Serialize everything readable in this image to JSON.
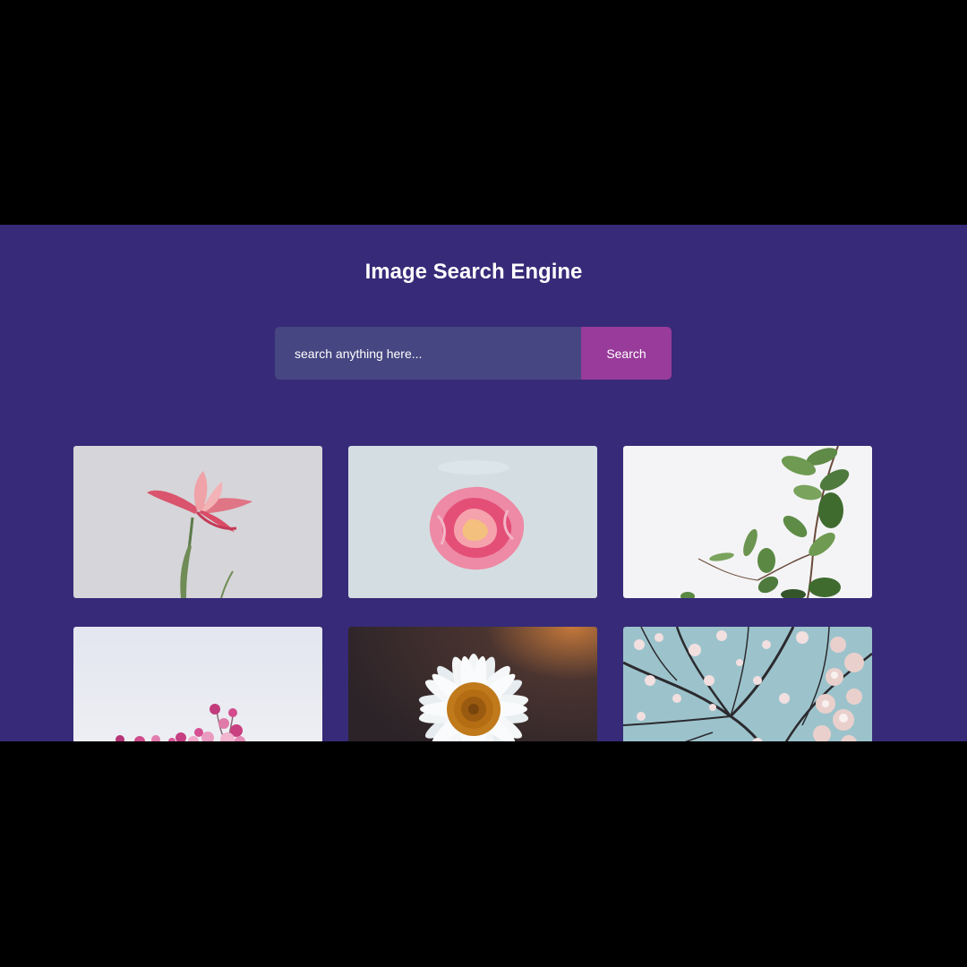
{
  "header": {
    "title": "Image Search Engine"
  },
  "search": {
    "placeholder": "search anything here...",
    "value": "",
    "button_label": "Search"
  },
  "colors": {
    "page_background": "#372a78",
    "input_background": "#464682",
    "button_background": "#983b9a",
    "text": "#ffffff"
  },
  "results": [
    {
      "subject": "pink iris flower"
    },
    {
      "subject": "pink rose bloom"
    },
    {
      "subject": "eucalyptus leaves"
    },
    {
      "subject": "pink blossoms"
    },
    {
      "subject": "white daisy"
    },
    {
      "subject": "cherry blossom branches"
    }
  ]
}
